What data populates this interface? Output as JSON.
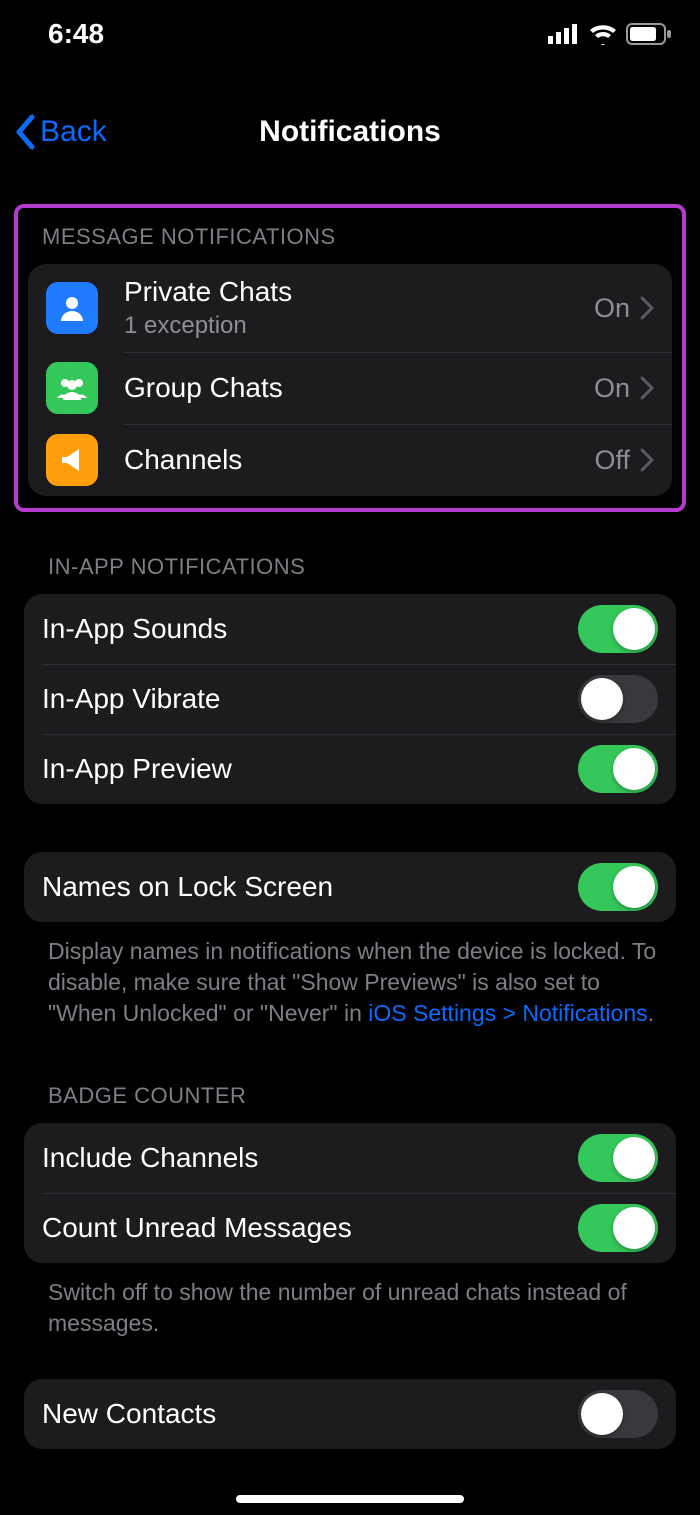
{
  "status": {
    "time": "6:48"
  },
  "nav": {
    "back": "Back",
    "title": "Notifications"
  },
  "sections": {
    "message": {
      "header": "MESSAGE NOTIFICATIONS",
      "rows": [
        {
          "title": "Private Chats",
          "sub": "1 exception",
          "value": "On"
        },
        {
          "title": "Group Chats",
          "value": "On"
        },
        {
          "title": "Channels",
          "value": "Off"
        }
      ]
    },
    "inapp": {
      "header": "IN-APP NOTIFICATIONS",
      "rows": [
        {
          "title": "In-App Sounds",
          "on": true
        },
        {
          "title": "In-App Vibrate",
          "on": false
        },
        {
          "title": "In-App Preview",
          "on": true
        }
      ]
    },
    "lock": {
      "rows": [
        {
          "title": "Names on Lock Screen",
          "on": true
        }
      ],
      "footer_pre": "Display names in notifications when the device is locked. To disable, make sure that \"Show Previews\" is also set to \"When Unlocked\" or \"Never\" in ",
      "footer_link": "iOS Settings > Notifications",
      "footer_post": "."
    },
    "badge": {
      "header": "BADGE COUNTER",
      "rows": [
        {
          "title": "Include Channels",
          "on": true
        },
        {
          "title": "Count Unread Messages",
          "on": true
        }
      ],
      "footer": "Switch off to show the number of unread chats instead of messages."
    },
    "newcontacts": {
      "rows": [
        {
          "title": "New Contacts",
          "on": false
        }
      ]
    }
  }
}
